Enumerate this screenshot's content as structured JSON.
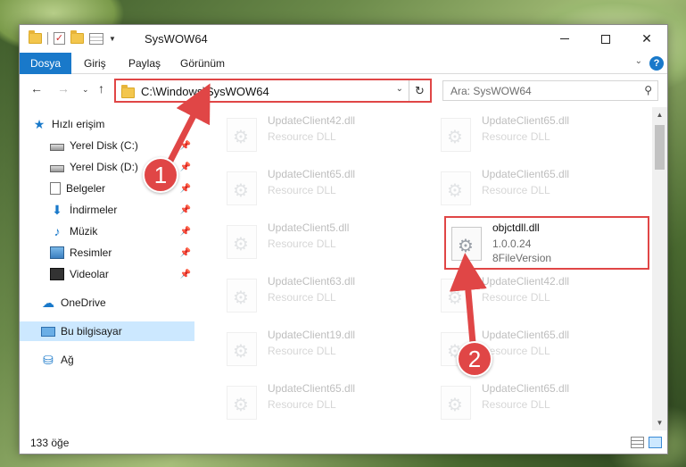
{
  "window": {
    "title": "SysWOW64"
  },
  "ribbon": {
    "tabs": [
      "Dosya",
      "Giriş",
      "Paylaş",
      "Görünüm"
    ],
    "help": "?"
  },
  "nav": {
    "address": "C:\\Windows\\SysWOW64",
    "search_placeholder": "Ara: SysWOW64"
  },
  "sidebar": {
    "items": [
      {
        "label": "Hızlı erişim",
        "icon": "star-icon"
      },
      {
        "label": "Yerel Disk (C:)",
        "icon": "disk-icon"
      },
      {
        "label": "Yerel Disk (D:)",
        "icon": "disk-icon"
      },
      {
        "label": "Belgeler",
        "icon": "documents-icon"
      },
      {
        "label": "İndirmeler",
        "icon": "download-icon"
      },
      {
        "label": "Müzik",
        "icon": "music-icon"
      },
      {
        "label": "Resimler",
        "icon": "pictures-icon"
      },
      {
        "label": "Videolar",
        "icon": "videos-icon"
      },
      {
        "label": "OneDrive",
        "icon": "cloud-icon"
      },
      {
        "label": "Bu bilgisayar",
        "icon": "computer-icon"
      },
      {
        "label": "Ağ",
        "icon": "network-icon"
      }
    ]
  },
  "files": [
    {
      "name": "UpdateClient42.dll",
      "desc": "Resource DLL"
    },
    {
      "name": "UpdateClient65.dll",
      "desc": "Resource DLL"
    },
    {
      "name": "UpdateClient65.dll",
      "desc": "Resource DLL"
    },
    {
      "name": "UpdateClient65.dll",
      "desc": "Resource DLL"
    },
    {
      "name": "UpdateClient5.dll",
      "desc": "Resource DLL"
    },
    {
      "name": "objctdll.dll",
      "desc": "1.0.0.24",
      "ver": "8FileVersion"
    },
    {
      "name": "UpdateClient63.dll",
      "desc": "Resource DLL"
    },
    {
      "name": "UpdateClient42.dll",
      "desc": "Resource DLL"
    },
    {
      "name": "UpdateClient19.dll",
      "desc": "Resource DLL"
    },
    {
      "name": "UpdateClient65.dll",
      "desc": "Resource DLL"
    },
    {
      "name": "UpdateClient65.dll",
      "desc": "Resource DLL"
    },
    {
      "name": "UpdateClient65.dll",
      "desc": "Resource DLL"
    }
  ],
  "status": {
    "count": "133 öğe"
  },
  "annotations": {
    "badge1": "1",
    "badge2": "2",
    "color": "#e04646"
  }
}
